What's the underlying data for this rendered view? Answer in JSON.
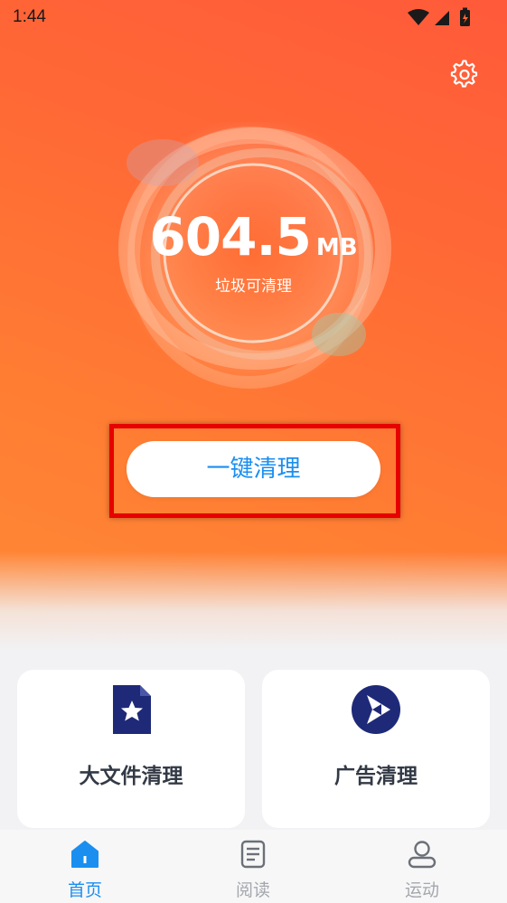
{
  "status_bar": {
    "time": "1:44"
  },
  "dial": {
    "value": "604.5",
    "unit": "MB",
    "caption": "垃圾可清理"
  },
  "clean_button": {
    "label": "一键清理"
  },
  "cards": [
    {
      "label": "大文件清理",
      "icon": "star-file-icon"
    },
    {
      "label": "广告清理",
      "icon": "play-circle-icon"
    }
  ],
  "tabs": [
    {
      "label": "首页",
      "icon": "home-icon",
      "active": true
    },
    {
      "label": "阅读",
      "icon": "document-icon",
      "active": false
    },
    {
      "label": "运动",
      "icon": "user-icon",
      "active": false
    }
  ],
  "colors": {
    "accent": "#1a8ff0",
    "hero_start": "#ff5a3a",
    "hero_end": "#ff8a36",
    "highlight": "#e60000",
    "icon_navy": "#1e2a78"
  }
}
